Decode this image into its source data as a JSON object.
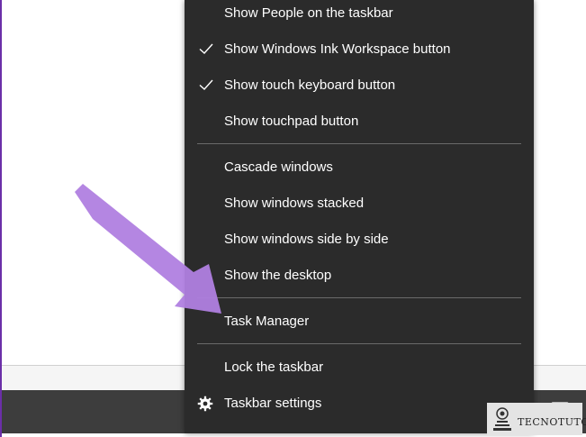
{
  "menu": {
    "items": [
      {
        "label": "Show People on the taskbar",
        "checked": false
      },
      {
        "label": "Show Windows Ink Workspace button",
        "checked": true
      },
      {
        "label": "Show touch keyboard button",
        "checked": true
      },
      {
        "label": "Show touchpad button",
        "checked": false
      },
      {
        "label": "Cascade windows",
        "checked": false
      },
      {
        "label": "Show windows stacked",
        "checked": false
      },
      {
        "label": "Show windows side by side",
        "checked": false
      },
      {
        "label": "Show the desktop",
        "checked": false
      },
      {
        "label": "Task Manager",
        "checked": false
      },
      {
        "label": "Lock the taskbar",
        "checked": false
      },
      {
        "label": "Taskbar settings",
        "checked": false,
        "icon": "gear-icon"
      }
    ]
  },
  "icons": {
    "check": "check-icon",
    "gear": "gear-icon",
    "annotation_arrow": "arrow-annotation-icon",
    "tray": "tray-keyboard-icon"
  },
  "watermark": {
    "brand": "TECNOTUTO"
  },
  "colors": {
    "menu_bg": "#2b2b2b",
    "menu_text": "#ffffff",
    "separator": "#6a6a6a",
    "taskbar_bg": "#3d3d3d",
    "arrow": "#b07fe0",
    "check": "#ffffff"
  }
}
